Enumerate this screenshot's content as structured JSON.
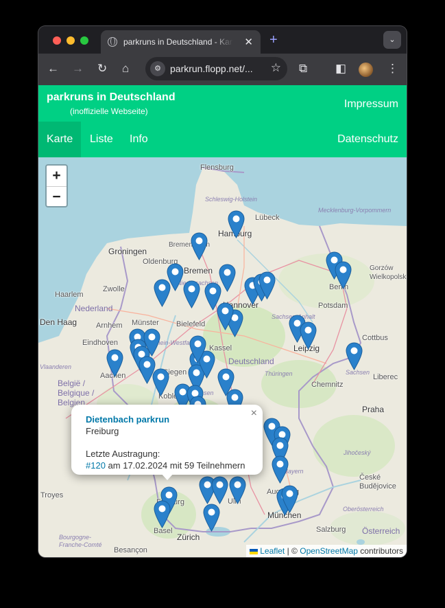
{
  "browser": {
    "tab_title": "parkruns in Deutschland - Karte",
    "url": "parkrun.flopp.net/..."
  },
  "site": {
    "title": "parkruns in Deutschland",
    "subtitle": "(inoffizielle Webseite)",
    "impressum": "Impressum",
    "nav": [
      {
        "label": "Karte",
        "active": true
      },
      {
        "label": "Liste",
        "active": false
      },
      {
        "label": "Info",
        "active": false
      }
    ],
    "datenschutz": "Datenschutz"
  },
  "map": {
    "zoom_in": "+",
    "zoom_out": "−",
    "countries": [
      "Nederland",
      "Deutschland",
      "België / Belgique / Belgien",
      "Praha",
      "Österreich"
    ],
    "cities": [
      "Flensburg",
      "Lübeck",
      "Hamburg",
      "Bremen",
      "Groningen",
      "Oldenburg",
      "Bremerhaven",
      "Zwolle",
      "Haarlem",
      "Den Haag",
      "Arnhem",
      "Münster",
      "Bielefeld",
      "Hannover",
      "Potsdam",
      "Berlin",
      "Gorzów Wielkopolski",
      "Eindhoven",
      "Aachen",
      "Siegen",
      "Koblenz",
      "Kassel",
      "Leipzig",
      "Cottbus",
      "Chemnitz",
      "Liberec",
      "Augsburg",
      "Ulm",
      "München",
      "Salzburg",
      "Freiburg",
      "Basel",
      "Zürich",
      "Troyes",
      "Besançon",
      "Bourgogne-Franche-Comté",
      "České Budějovice"
    ],
    "regions": [
      "Schleswig-Holstein",
      "Mecklenburg-Vorpommern",
      "Niedersachsen",
      "Sachsen-Anhalt",
      "Nordrhein-Westfalen",
      "Thüringen",
      "Hessen",
      "Sachsen",
      "Bayern",
      "Jihočeský",
      "Oberösterreich",
      "Vlaanderen"
    ],
    "popup": {
      "title": "Dietenbach parkrun",
      "city": "Freiburg",
      "last_label": "Letzte Austragung:",
      "event_number": "#120",
      "event_text": "am 17.02.2024 mit 59 Teilnehmern",
      "close": "×"
    },
    "attribution": {
      "leaflet": "Leaflet",
      "separator": "| ©",
      "osm": "OpenStreetMap",
      "suffix": "contributors"
    },
    "marker_color": "#2a81cb",
    "marker_count": 45
  },
  "colors": {
    "brand": "#00d084",
    "brand_active": "#00b873",
    "link": "#0078a8"
  }
}
